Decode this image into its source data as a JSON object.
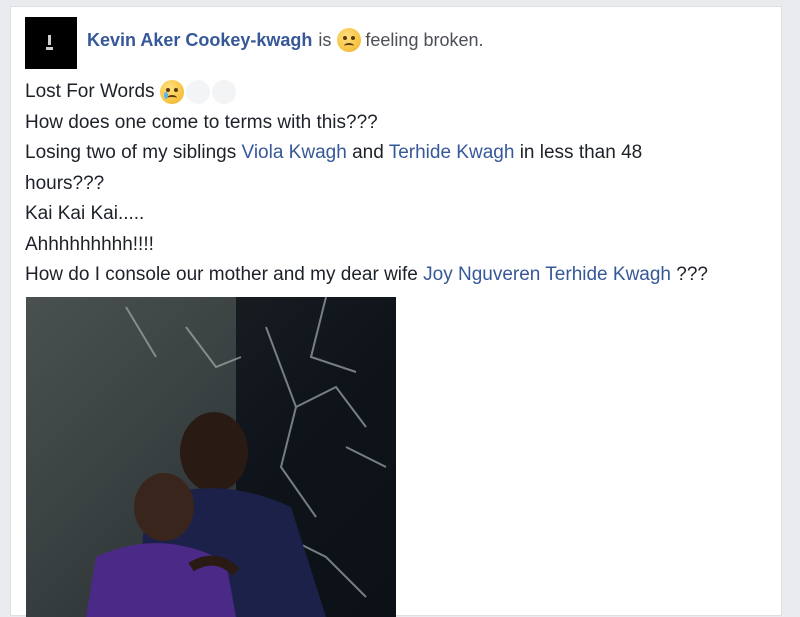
{
  "post": {
    "author": "Kevin Aker Cookey-kwagh",
    "is_word": "is",
    "feeling_text": "feeling broken.",
    "feeling_icon": "confounded-face-icon",
    "lines": {
      "l1": "Lost For Words",
      "l2": "How does one come to terms with this???",
      "l3_a": "Losing two of my siblings",
      "l3_link1": "Viola Kwagh",
      "l3_and": "and",
      "l3_link2": "Terhide Kwagh",
      "l3_b": "in less than 48",
      "l4": "hours???",
      "l5": "Kai Kai Kai.....",
      "l6": "Ahhhhhhhhh!!!!",
      "l7_a": "How do I console our mother and my dear wife",
      "l7_link": "Joy Nguveren Terhide Kwagh",
      "l7_b": "???"
    }
  },
  "colors": {
    "link": "#365899",
    "text": "#1d2129",
    "muted": "#4b4f56",
    "background": "#e9ebee"
  }
}
